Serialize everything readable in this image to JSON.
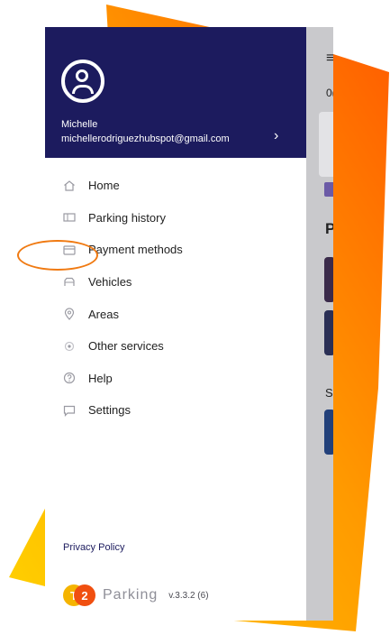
{
  "colors": {
    "header_bg": "#1c1b5e",
    "accent_orange": "#f07a12",
    "accent_yellow": "#ffcc00",
    "menu_icon": "#9a9aa2"
  },
  "user": {
    "name": "Michelle",
    "email": "michellerodriguezhubspot@gmail.com"
  },
  "menu": {
    "items": [
      {
        "label": "Home",
        "icon": "home-icon"
      },
      {
        "label": "Parking history",
        "icon": "ticket-icon"
      },
      {
        "label": "Payment methods",
        "icon": "credit-card-icon"
      },
      {
        "label": "Vehicles",
        "icon": "vehicle-icon"
      },
      {
        "label": "Areas",
        "icon": "map-pin-icon"
      },
      {
        "label": "Other services",
        "icon": "services-icon"
      },
      {
        "label": "Help",
        "icon": "help-icon"
      },
      {
        "label": "Settings",
        "icon": "chat-icon"
      }
    ]
  },
  "footer": {
    "privacy_label": "Privacy Policy",
    "logo_t": "T",
    "logo_2": "2",
    "brand": "Parking",
    "version": "v.3.3.2 (6)"
  },
  "background": {
    "hamburger": "≡",
    "text0": "0(",
    "big_p": "P",
    "s_label": "S"
  }
}
